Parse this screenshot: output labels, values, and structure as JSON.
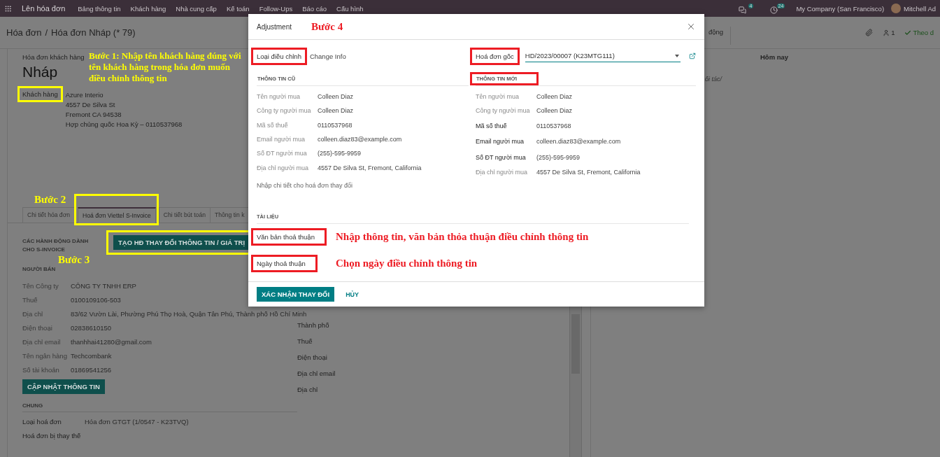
{
  "navbar": {
    "app_title": "Lên hóa đơn",
    "menu": [
      "Bảng thông tin",
      "Khách hàng",
      "Nhà cung cấp",
      "Kế toán",
      "Follow-Ups",
      "Báo cáo",
      "Cấu hình"
    ],
    "messages_badge": "4",
    "activities_badge": "24",
    "company": "My Company (San Francisco)",
    "user": "Mitchell Ad"
  },
  "breadcrumb": {
    "parent": "Hóa đơn",
    "separator": "/",
    "current": "Hóa đơn Nháp (* 79)",
    "action_partial": "động",
    "followers": "1",
    "follow": "Theo d"
  },
  "invoice": {
    "type_label": "Hóa đơn khách hàng",
    "status": "Nháp",
    "customer": {
      "label": "Khách hàng",
      "outlined": true,
      "address": [
        "Azure Interio",
        "4557 De Silva St",
        "Fremont CA 94538",
        "Hợp chủng quốc Hoa Kỳ – 0110537968"
      ],
      "annotation": "Bước 1: Nhập tên khách hàng đúng với tên khách hàng trong hóa đơn muốn điều chỉnh thông tin"
    }
  },
  "tabs": {
    "annotation": "Bước 2",
    "items": [
      {
        "label": "Chi tiết hóa đơn",
        "selected": false,
        "outlined": false
      },
      {
        "label": "Hoá đơn Viettel S-Invoice",
        "selected": true,
        "outlined": true
      },
      {
        "label": "Chi tiết bút toán",
        "selected": false,
        "outlined": false
      },
      {
        "label": "Thông tin k",
        "selected": false,
        "outlined": false
      }
    ]
  },
  "s_invoice": {
    "heading": "CÁC HÀNH ĐỘNG DÀNH CHO S-INVOICE",
    "button": {
      "label": "TẠO HĐ THAY ĐỔI THÔNG TIN / GIÁ TRỊ",
      "outlined": true
    },
    "annotation": "Bước 3",
    "seller": {
      "heading": "NGƯỜI BÁN",
      "rows": [
        {
          "label": "Tên Công ty",
          "value": "CÔNG TY TNHH ERP"
        },
        {
          "label": "Thuế",
          "value": "0100109106-503"
        },
        {
          "label": "Địa chỉ",
          "value": "83/62 Vườn Lài, Phường Phú Thọ Hoà, Quận Tân Phú, Thành phố Hồ Chí Minh"
        },
        {
          "label": "Điện thoại",
          "value": "02838610150"
        },
        {
          "label": "Địa chỉ email",
          "value": "thanhhai41280@gmail.com"
        },
        {
          "label": "Tên ngân hàng",
          "value": "Techcombank"
        },
        {
          "label": "Số tài khoản",
          "value": "01869541256"
        }
      ]
    },
    "update_button": "CẬP NHẬT THÔNG TIN",
    "general": {
      "heading": "CHUNG",
      "rows": [
        {
          "label": "Loại hoá đơn",
          "value": "Hóa đơn GTGT (1/0547 - K23TVQ)"
        },
        {
          "label": "Hoá đơn bị thay thế"
        }
      ]
    },
    "buyer_labels": [
      "Thành phố",
      "Thuế",
      "Điện thoại",
      "Địa chỉ email",
      "Địa chỉ"
    ]
  },
  "chatter": {
    "day": "Hôm nay",
    "partial_text": "ối tác/"
  },
  "dialog": {
    "title": "Adjustment",
    "annotation": "Bước 4",
    "adjustment_type": {
      "label": "Loại điều chỉnh",
      "value": "Change Info",
      "outlined": true
    },
    "original_invoice": {
      "label": "Hoá đơn gốc",
      "value": "HD/2023/00007 (K23MTG111)",
      "outlined": true
    },
    "old_info": {
      "heading": "THÔNG TIN CŨ",
      "rows": [
        {
          "label": "Tên người mua",
          "value": "Colleen Diaz"
        },
        {
          "label": "Công ty người mua",
          "value": "Colleen Diaz"
        },
        {
          "label": "Mã số thuế",
          "value": "0110537968"
        },
        {
          "label": "Email người mua",
          "value": "colleen.diaz83@example.com"
        },
        {
          "label": "Số ĐT người mua",
          "value": "(255)-595-9959"
        },
        {
          "label": "Địa chỉ người mua",
          "value": "4557 De Silva St, Fremont, California"
        }
      ]
    },
    "new_info": {
      "heading": "THÔNG TIN MỚI",
      "outlined": true,
      "rows": [
        {
          "label": "Tên người mua",
          "value": "Colleen Diaz",
          "required": false
        },
        {
          "label": "Công ty người mua",
          "value": "Colleen Diaz",
          "required": false
        },
        {
          "label": "Mã số thuế",
          "value": "0110537968",
          "required": true
        },
        {
          "label": "Email người mua",
          "value": "colleen.diaz83@example.com",
          "required": true
        },
        {
          "label": "Số ĐT người mua",
          "value": "(255)-595-9959",
          "required": true
        },
        {
          "label": "Địa chỉ người mua",
          "value": "4557 De Silva St, Fremont, California",
          "required": false
        }
      ]
    },
    "details_hint": "Nhập chi tiết cho hoá đơn thay đổi",
    "documents": {
      "heading": "TÀI LIỆU",
      "fields": [
        {
          "label": "Văn bản thoả thuận",
          "outlined": true,
          "annotation": "Nhập thông tin, văn bản thỏa thuận điều chỉnh thông tin"
        },
        {
          "label": "Ngày thoả thuận",
          "outlined": true,
          "annotation": "Chọn ngày điều chỉnh thông tin"
        }
      ]
    },
    "buttons": {
      "confirm": "XÁC NHẬN THAY ĐỔI",
      "cancel": "HỦY"
    }
  }
}
